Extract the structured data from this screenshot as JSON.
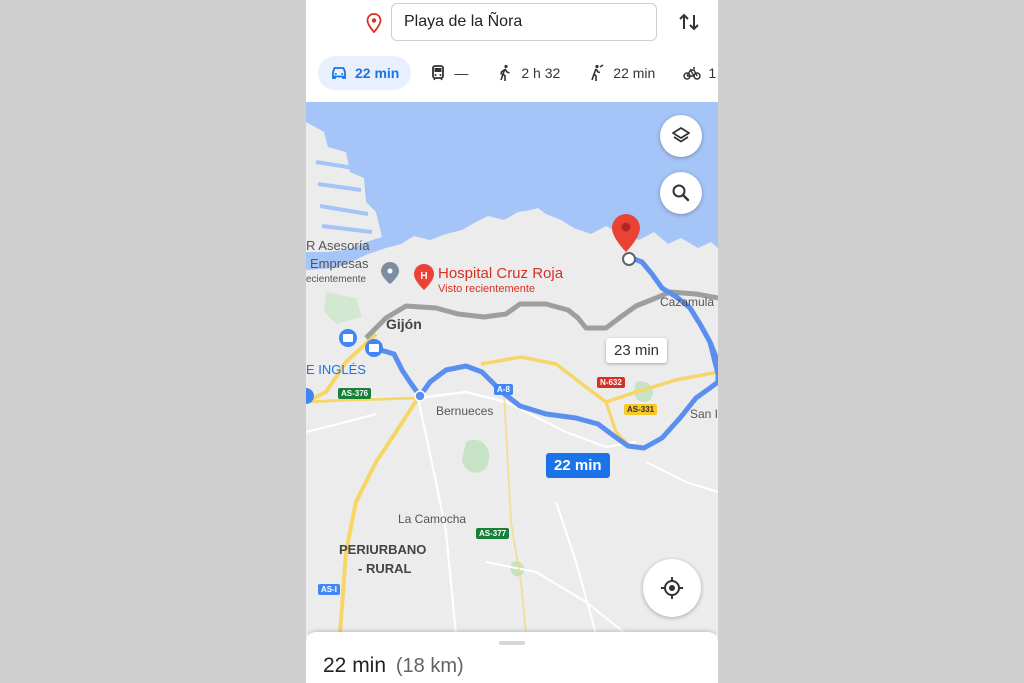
{
  "search": {
    "destination": "Playa de la Ñora"
  },
  "modes": [
    {
      "name": "car",
      "label": "22 min",
      "active": true
    },
    {
      "name": "transit",
      "label": "—",
      "active": false
    },
    {
      "name": "walk",
      "label": "2 h 32",
      "active": false
    },
    {
      "name": "ride",
      "label": "22 min",
      "active": false
    },
    {
      "name": "bike",
      "label": "1",
      "active": false
    }
  ],
  "map": {
    "places": {
      "asesoria_1": "R Asesoría",
      "asesoria_2": "Empresas",
      "asesoria_3": "ecientemente",
      "hospital": "Hospital Cruz Roja",
      "hospital_sub": "Visto recientemente",
      "gijon": "Gijón",
      "ingles": "E INGLÉS",
      "cazamula": "Cazamula",
      "bernueces": "Bernueces",
      "san": "San I",
      "camocha": "La Camocha",
      "periurbano_1": "PERIURBANO",
      "periurbano_2": "- RURAL"
    },
    "roads": {
      "as376": "AS-376",
      "a8": "A-8",
      "n632": "N-632",
      "as331": "AS-331",
      "as377": "AS-377",
      "as_left": "AS-I"
    },
    "routes": {
      "alt_time": "23 min",
      "main_time": "22 min"
    },
    "colors": {
      "water": "#a5c4f7",
      "route": "#5a8ff0",
      "alt_route": "#a9a9a9",
      "pin": "#ea4335"
    }
  },
  "summary": {
    "time": "22 min",
    "distance": "(18 km)"
  }
}
